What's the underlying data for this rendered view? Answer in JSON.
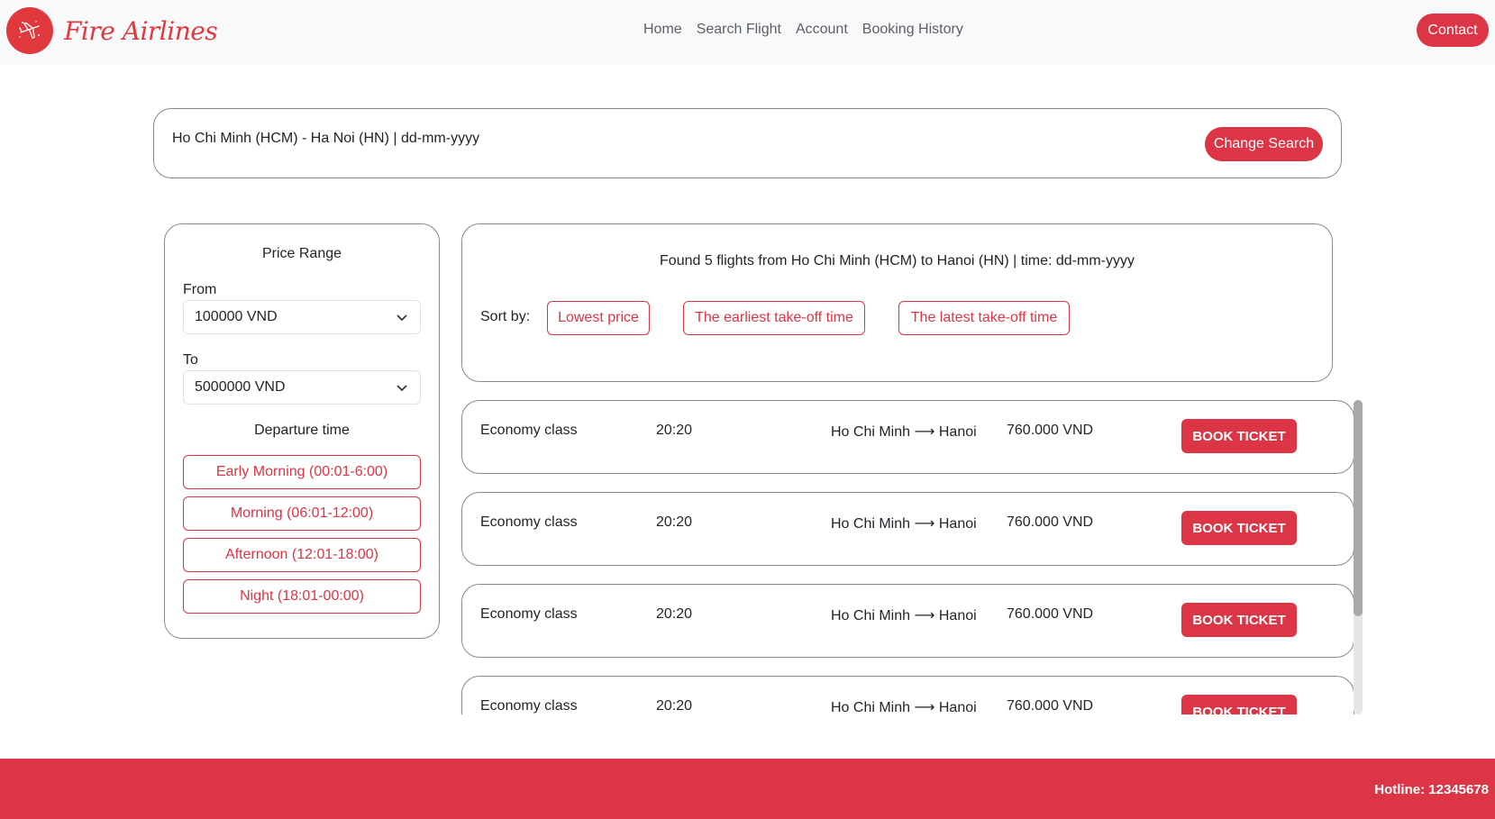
{
  "brand": {
    "name": "Fire Airlines",
    "logo_icon": "airplane-icon",
    "accent": "#dc3545"
  },
  "nav": {
    "items": [
      "Home",
      "Search Flight",
      "Account",
      "Booking History"
    ],
    "contact_label": "Contact"
  },
  "search": {
    "summary": "Ho Chi Minh (HCM) - Ha Noi (HN) | dd-mm-yyyy",
    "change_label": "Change Search"
  },
  "filters": {
    "price_heading": "Price Range",
    "from_label": "From",
    "from_value": "100000 VND",
    "to_label": "To",
    "to_value": "5000000 VND",
    "departure_heading": "Departure time",
    "times": [
      "Early Morning (00:01-6:00)",
      "Morning (06:01-12:00)",
      "Afternoon (12:01-18:00)",
      "Night (18:01-00:00)"
    ]
  },
  "results": {
    "found_text": "Found 5 flights from Ho Chi Minh (HCM) to Hanoi (HN) | time: dd-mm-yyyy",
    "sort_label": "Sort by:",
    "sort_options": [
      "Lowest price",
      "The earliest take-off time",
      "The latest take-off time"
    ]
  },
  "flights": [
    {
      "class": "Economy class",
      "time": "20:20",
      "route": "Ho Chi Minh ⟶ Hanoi",
      "price": "760.000 VND",
      "action": "BOOK TICKET"
    },
    {
      "class": "Economy class",
      "time": "20:20",
      "route": "Ho Chi Minh ⟶ Hanoi",
      "price": "760.000 VND",
      "action": "BOOK TICKET"
    },
    {
      "class": "Economy class",
      "time": "20:20",
      "route": "Ho Chi Minh ⟶ Hanoi",
      "price": "760.000 VND",
      "action": "BOOK TICKET"
    },
    {
      "class": "Economy class",
      "time": "20:20",
      "route": "Ho Chi Minh ⟶ Hanoi",
      "price": "760.000 VND",
      "action": "BOOK TICKET"
    }
  ],
  "footer": {
    "hotline": "Hotline: 12345678"
  }
}
